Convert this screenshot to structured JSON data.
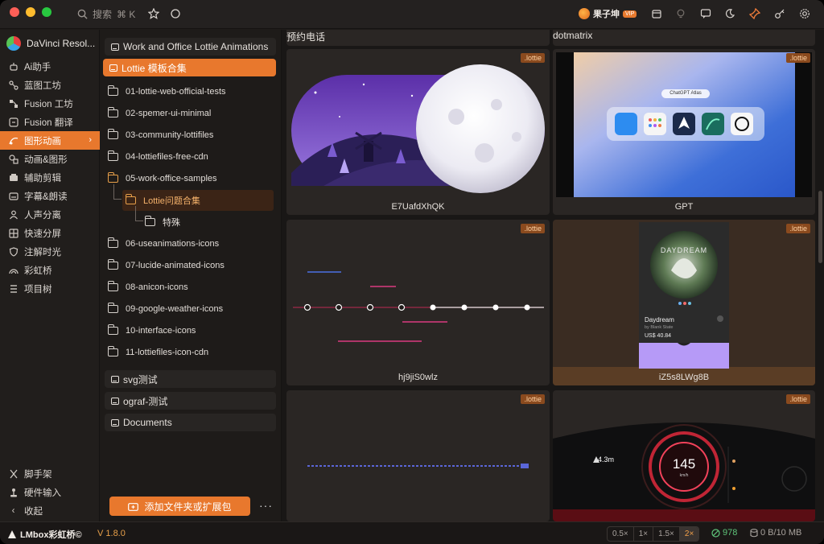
{
  "titlebar": {
    "search_placeholder": "搜索",
    "search_shortcut": "⌘ K",
    "user_name": "果子坤",
    "user_badge": "VIP"
  },
  "sidebar": {
    "app_name": "DaVinci Resol...",
    "items": [
      {
        "label": "Ai助手",
        "icon": "robot-icon"
      },
      {
        "label": "蓝图工坊",
        "icon": "blueprint-icon"
      },
      {
        "label": "Fusion 工坊",
        "icon": "fusion-nodes-icon"
      },
      {
        "label": "Fusion 翻译",
        "icon": "translate-icon"
      },
      {
        "label": "图形动画",
        "icon": "motion-icon",
        "active": true
      },
      {
        "label": "动画&图形",
        "icon": "shapes-icon"
      },
      {
        "label": "辅助剪辑",
        "icon": "edit-icon"
      },
      {
        "label": "字幕&朗读",
        "icon": "subtitle-icon"
      },
      {
        "label": "人声分离",
        "icon": "person-icon"
      },
      {
        "label": "快速分屏",
        "icon": "split-icon"
      },
      {
        "label": "注解时光",
        "icon": "shield-icon"
      },
      {
        "label": "彩虹桥",
        "icon": "rainbow-icon"
      },
      {
        "label": "项目树",
        "icon": "tree-icon"
      }
    ],
    "bottom_items": [
      {
        "label": "脚手架",
        "icon": "scaffold-icon"
      },
      {
        "label": "硬件输入",
        "icon": "joystick-icon"
      },
      {
        "label": "收起",
        "icon": "chevron-left-icon"
      }
    ]
  },
  "folders": {
    "group1": "Work and Office Lottie Animations",
    "group2": "Lottie 模板合集",
    "items": [
      "01-lottie-web-official-tests",
      "02-spemer-ui-minimal",
      "03-community-lottifiles",
      "04-lottiefiles-free-cdn",
      "05-work-office-samples",
      "Lottie问题合集",
      "特殊",
      "06-useanimations-icons",
      "07-lucide-animated-icons",
      "08-anicon-icons",
      "09-google-weather-icons",
      "10-interface-icons",
      "11-lottiefiles-icon-cdn"
    ],
    "group3": "svg测试",
    "group4": "ograf-测试",
    "group5": "Documents",
    "add_button": "添加文件夹或扩展包",
    "more": "···"
  },
  "grid": {
    "top_left_name": "预约电话",
    "top_right_name": "dotmatrix",
    "cards": [
      {
        "name": "E7UafdXhQK",
        "tag": ".lottie"
      },
      {
        "name": "GPT",
        "tag": ".lottie"
      },
      {
        "name": "hj9jiS0wlz",
        "tag": ".lottie"
      },
      {
        "name": "iZ5s8LWg8B",
        "tag": ".lottie"
      },
      {
        "name": "",
        "tag": ".lottie"
      },
      {
        "name": "",
        "tag": ".lottie"
      }
    ],
    "gpt_pill": "ChatGPT Atlas",
    "daydream": {
      "title": "Daydream",
      "artist": "by Blank State",
      "price": "US$ 40.84",
      "cover_text": "DAYDREAM"
    },
    "dash": {
      "speed": "145",
      "speed_unit": "km/h",
      "distance": "4.3m"
    }
  },
  "footer": {
    "brand": "LMbox彩虹桥©",
    "version": "V 1.8.0",
    "zooms": [
      "0.5×",
      "1×",
      "1.5×",
      "2×"
    ],
    "active_zoom": "2×",
    "count": "978",
    "size": "0 B/10 MB"
  }
}
